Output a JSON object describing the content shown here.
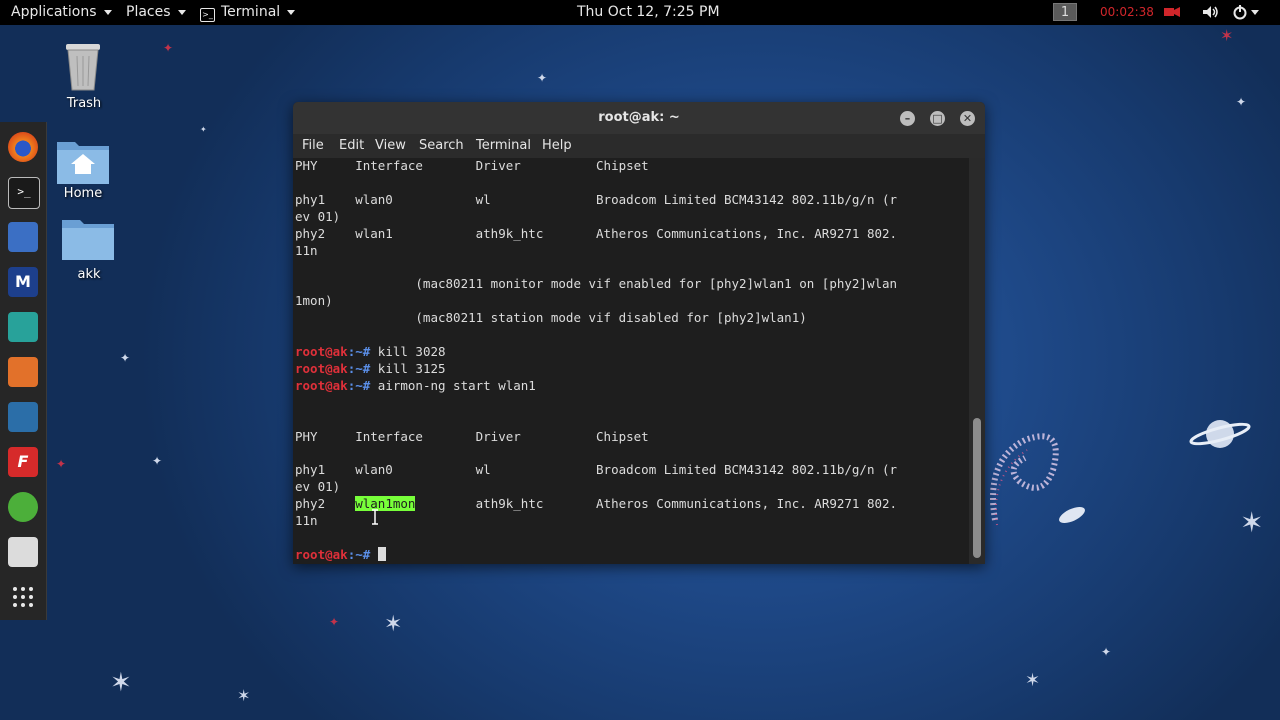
{
  "topbar": {
    "applications": "Applications",
    "places": "Places",
    "terminal": "Terminal",
    "datetime": "Thu Oct 12,  7:25 PM",
    "workspace": "1",
    "timer": "00:02:38"
  },
  "desktop": {
    "trash": "Trash",
    "home": "Home",
    "akk": "akk"
  },
  "window": {
    "title": "root@ak: ~",
    "menu": [
      "File",
      "Edit",
      "View",
      "Search",
      "Terminal",
      "Help"
    ]
  },
  "terminal": {
    "prompt_user": "root@ak",
    "prompt_path": ":~#",
    "lines": [
      "PHY     Interface       Driver          Chipset",
      "",
      "phy1    wlan0           wl              Broadcom Limited BCM43142 802.11b/g/n (r",
      "ev 01)",
      "phy2    wlan1           ath9k_htc       Atheros Communications, Inc. AR9271 802.",
      "11n",
      "",
      "                (mac80211 monitor mode vif enabled for [phy2]wlan1 on [phy2]wlan",
      "1mon)",
      "                (mac80211 station mode vif disabled for [phy2]wlan1)",
      ""
    ],
    "commands": [
      " kill 3028",
      " kill 3125",
      " airmon-ng start wlan1"
    ],
    "lines2": [
      "",
      "",
      "PHY     Interface       Driver          Chipset",
      "",
      "phy1    wlan0           wl              Broadcom Limited BCM43142 802.11b/g/n (r",
      "ev 01)"
    ],
    "phy2_prefix": "phy2    ",
    "phy2_iface": "wlan1mon",
    "phy2_rest": "        ath9k_htc       Atheros Communications, Inc. AR9271 802.",
    "tail": "11n",
    "blank": ""
  },
  "colors": {
    "prompt_user": "#e0303a",
    "prompt_path": "#5b8fe8",
    "highlight": "#78ff3a"
  }
}
